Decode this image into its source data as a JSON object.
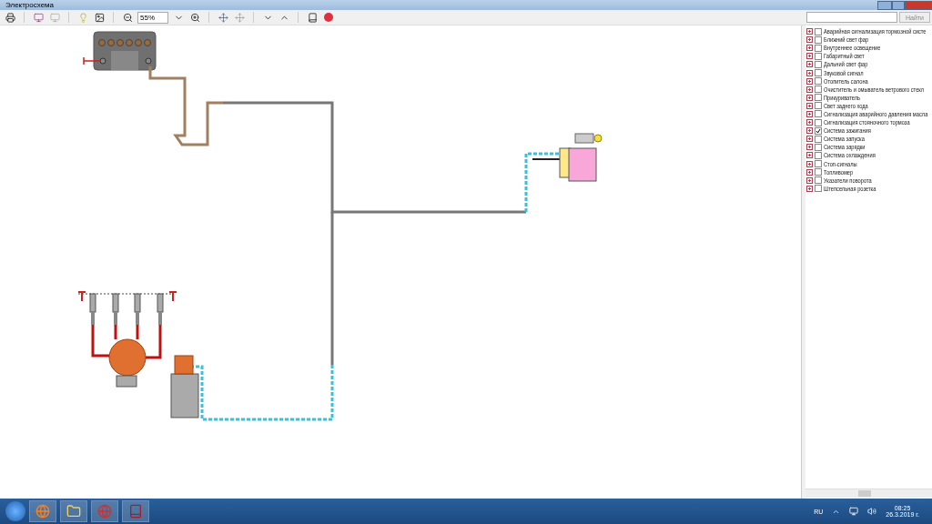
{
  "window": {
    "title": "Электросхема"
  },
  "toolbar": {
    "zoom": "55%"
  },
  "search": {
    "button": "Найти"
  },
  "systems": [
    {
      "label": "Аварийная сигнализация тормозной систе",
      "checked": false
    },
    {
      "label": "Ближний свет фар",
      "checked": false
    },
    {
      "label": "Внутреннее освещение",
      "checked": false
    },
    {
      "label": "Габаритный свет",
      "checked": false
    },
    {
      "label": "Дальний свет фар",
      "checked": false
    },
    {
      "label": "Звуковой сигнал",
      "checked": false
    },
    {
      "label": "Отопитель салона",
      "checked": false
    },
    {
      "label": "Очиститель и омыватель ветрового стекл",
      "checked": false
    },
    {
      "label": "Прикуриватель",
      "checked": false
    },
    {
      "label": "Свет заднего хода",
      "checked": false
    },
    {
      "label": "Сигнализация аварийного давления масла",
      "checked": false
    },
    {
      "label": "Сигнализация стояночного тормоза",
      "checked": false
    },
    {
      "label": "Система зажигания",
      "checked": true
    },
    {
      "label": "Система запуска",
      "checked": false
    },
    {
      "label": "Система зарядки",
      "checked": false
    },
    {
      "label": "Система охлаждения",
      "checked": false
    },
    {
      "label": "Стоп-сигналы",
      "checked": false
    },
    {
      "label": "Топливомер",
      "checked": false
    },
    {
      "label": "Указатели поворота",
      "checked": false
    },
    {
      "label": "Штепсельная розетка",
      "checked": false
    }
  ],
  "taskbar": {
    "language": "RU",
    "time": "08:25",
    "date": "26.3.2019 г."
  }
}
